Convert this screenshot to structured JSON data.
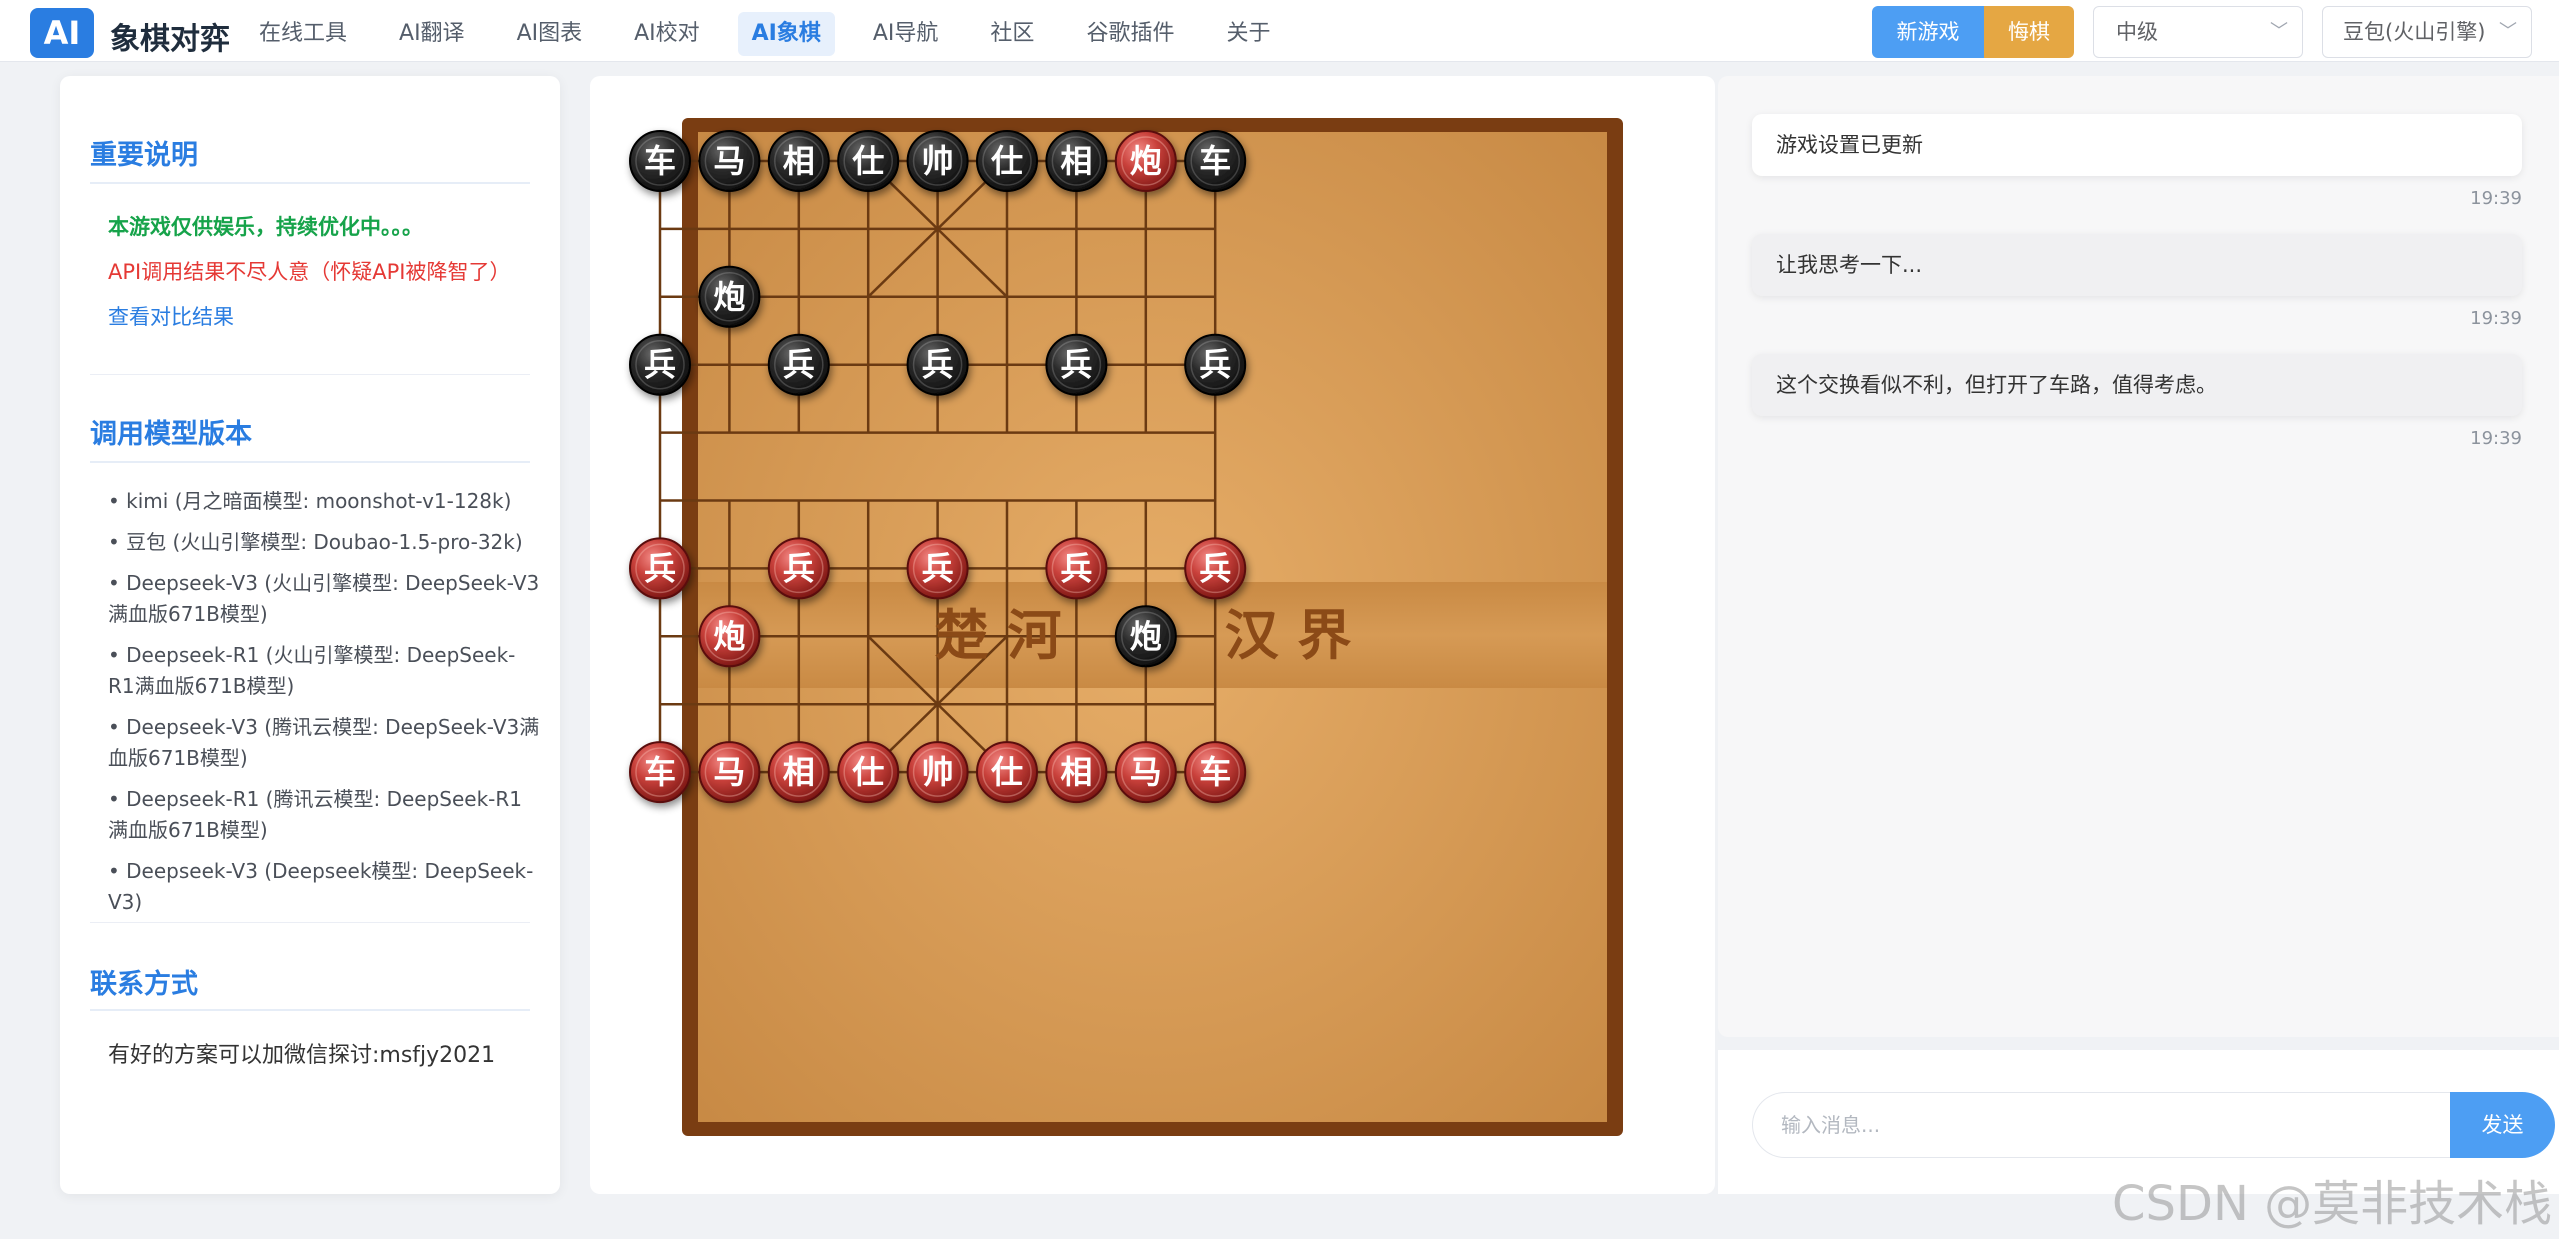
{
  "header": {
    "logo": "AI",
    "title": "象棋对弈",
    "nav": [
      "在线工具",
      "AI翻译",
      "AI图表",
      "AI校对",
      "AI象棋",
      "AI导航",
      "社区",
      "谷歌插件",
      "关于"
    ],
    "active_nav": "AI象棋",
    "new_game_label": "新游戏",
    "undo_label": "悔棋",
    "level_value": "中级",
    "model_value": "豆包(火山引擎)"
  },
  "left": {
    "notice_title": "重要说明",
    "notice_green": "本游戏仅供娱乐，持续优化中。。。",
    "notice_red": "API调用结果不尽人意（怀疑API被降智了）",
    "notice_link": "查看对比结果",
    "models_title": "调用模型版本",
    "models": [
      "• kimi (月之暗面模型: moonshot-v1-128k)",
      "• 豆包 (火山引擎模型: Doubao-1.5-pro-32k)",
      "• Deepseek-V3 (火山引擎模型: DeepSeek-V3满血版671B模型)",
      "• Deepseek-R1 (火山引擎模型: DeepSeek-R1满血版671B模型)",
      "• Deepseek-V3 (腾讯云模型: DeepSeek-V3满血版671B模型)",
      "• Deepseek-R1 (腾讯云模型: DeepSeek-R1满血版671B模型)",
      "• Deepseek-V3 (Deepseek模型: DeepSeek-V3)"
    ],
    "contact_title": "联系方式",
    "contact_text": "有好的方案可以加微信探讨:msfjy2021"
  },
  "board": {
    "river_left": "楚 河",
    "river_right": "汉 界",
    "colors": {
      "red": "#c0392b",
      "black": "#222222",
      "wood": "#d9a05a",
      "frame": "#7a3d12"
    },
    "pieces": [
      {
        "c": "b",
        "t": "车",
        "col": 0,
        "row": 0
      },
      {
        "c": "b",
        "t": "马",
        "col": 1,
        "row": 0
      },
      {
        "c": "b",
        "t": "相",
        "col": 2,
        "row": 0
      },
      {
        "c": "b",
        "t": "仕",
        "col": 3,
        "row": 0
      },
      {
        "c": "b",
        "t": "帅",
        "col": 4,
        "row": 0
      },
      {
        "c": "b",
        "t": "仕",
        "col": 5,
        "row": 0
      },
      {
        "c": "b",
        "t": "相",
        "col": 6,
        "row": 0
      },
      {
        "c": "r",
        "t": "炮",
        "col": 7,
        "row": 0
      },
      {
        "c": "b",
        "t": "车",
        "col": 8,
        "row": 0
      },
      {
        "c": "b",
        "t": "炮",
        "col": 1,
        "row": 2
      },
      {
        "c": "b",
        "t": "兵",
        "col": 0,
        "row": 3
      },
      {
        "c": "b",
        "t": "兵",
        "col": 2,
        "row": 3
      },
      {
        "c": "b",
        "t": "兵",
        "col": 4,
        "row": 3
      },
      {
        "c": "b",
        "t": "兵",
        "col": 6,
        "row": 3
      },
      {
        "c": "b",
        "t": "兵",
        "col": 8,
        "row": 3
      },
      {
        "c": "r",
        "t": "兵",
        "col": 0,
        "row": 6
      },
      {
        "c": "r",
        "t": "兵",
        "col": 2,
        "row": 6
      },
      {
        "c": "r",
        "t": "兵",
        "col": 4,
        "row": 6
      },
      {
        "c": "r",
        "t": "兵",
        "col": 6,
        "row": 6
      },
      {
        "c": "r",
        "t": "兵",
        "col": 8,
        "row": 6
      },
      {
        "c": "r",
        "t": "炮",
        "col": 1,
        "row": 7
      },
      {
        "c": "b",
        "t": "炮",
        "col": 7,
        "row": 7
      },
      {
        "c": "r",
        "t": "车",
        "col": 0,
        "row": 9
      },
      {
        "c": "r",
        "t": "马",
        "col": 1,
        "row": 9
      },
      {
        "c": "r",
        "t": "相",
        "col": 2,
        "row": 9
      },
      {
        "c": "r",
        "t": "仕",
        "col": 3,
        "row": 9
      },
      {
        "c": "r",
        "t": "帅",
        "col": 4,
        "row": 9
      },
      {
        "c": "r",
        "t": "仕",
        "col": 5,
        "row": 9
      },
      {
        "c": "r",
        "t": "相",
        "col": 6,
        "row": 9
      },
      {
        "c": "r",
        "t": "马",
        "col": 7,
        "row": 9
      },
      {
        "c": "r",
        "t": "车",
        "col": 8,
        "row": 9
      }
    ]
  },
  "chat": {
    "messages": [
      {
        "text": "游戏设置已更新",
        "time": "19:39"
      },
      {
        "text": "让我思考一下...",
        "time": "19:39"
      },
      {
        "text": "这个交换看似不利，但打开了车路，值得考虑。",
        "time": "19:39"
      }
    ],
    "input_placeholder": "输入消息...",
    "send_label": "发送"
  },
  "watermark": "CSDN @莫非技术栈"
}
